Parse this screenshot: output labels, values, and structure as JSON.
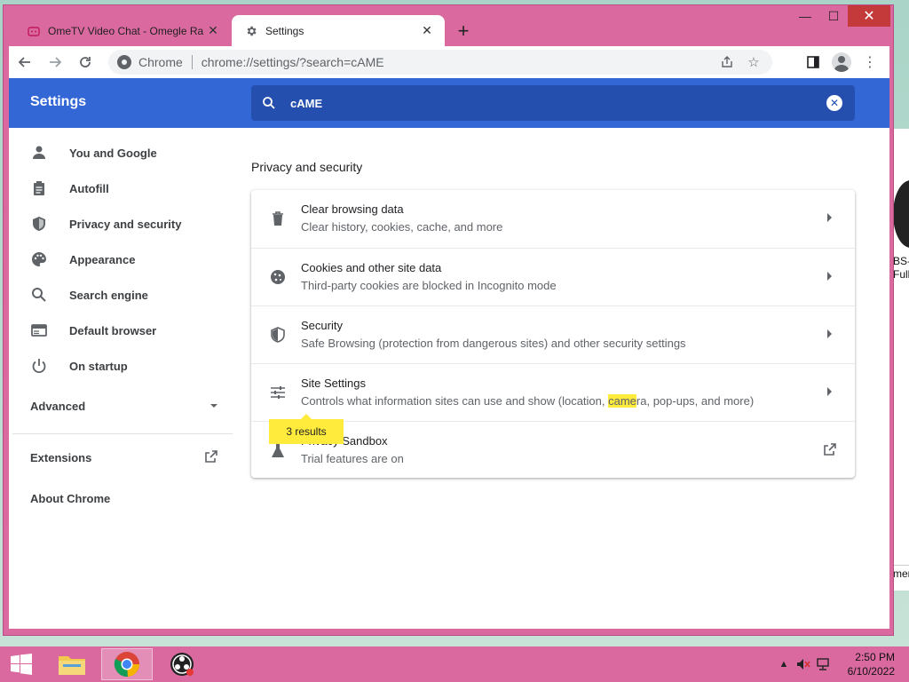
{
  "window": {
    "tabs": [
      {
        "title": "OmeTV Video Chat - Omegle Ra",
        "active": false
      },
      {
        "title": "Settings",
        "active": true
      }
    ],
    "controls": {
      "minimize": "—",
      "maximize": "☐",
      "close": "✕"
    }
  },
  "toolbar": {
    "site_chip": "Chrome",
    "url": "chrome://settings/?search=cAME"
  },
  "settings": {
    "header_title": "Settings",
    "search_value": "cAME",
    "sidebar": {
      "items": [
        {
          "label": "You and Google",
          "icon": "person-icon"
        },
        {
          "label": "Autofill",
          "icon": "clipboard-icon"
        },
        {
          "label": "Privacy and security",
          "icon": "shield-icon"
        },
        {
          "label": "Appearance",
          "icon": "palette-icon"
        },
        {
          "label": "Search engine",
          "icon": "search-icon"
        },
        {
          "label": "Default browser",
          "icon": "browser-icon"
        },
        {
          "label": "On startup",
          "icon": "power-icon"
        }
      ],
      "advanced": "Advanced",
      "extensions": "Extensions",
      "about": "About Chrome"
    },
    "section_title": "Privacy and security",
    "rows": [
      {
        "title": "Clear browsing data",
        "subtitle": "Clear history, cookies, cache, and more"
      },
      {
        "title": "Cookies and other site data",
        "subtitle": "Third-party cookies are blocked in Incognito mode"
      },
      {
        "title": "Security",
        "subtitle": "Safe Browsing (protection from dangerous sites) and other security settings"
      },
      {
        "title": "Site Settings",
        "subtitle_before": "Controls what information sites can use and show (location, ",
        "subtitle_highlight": "came",
        "subtitle_after": "ra, pop-ups, and more)"
      },
      {
        "title": "Privacy Sandbox",
        "subtitle": "Trial features are on"
      }
    ],
    "results_bubble": "3 results"
  },
  "desktop": {
    "side_label_1": "BS-S",
    "side_label_2": "Full",
    "side_label_3": "mer"
  },
  "taskbar": {
    "time": "2:50 PM",
    "date": "6/10/2022"
  },
  "colors": {
    "accent": "#3367d6",
    "search_bg": "#254fae",
    "highlight": "#ffeb3b",
    "window_frame": "#d9699f"
  }
}
